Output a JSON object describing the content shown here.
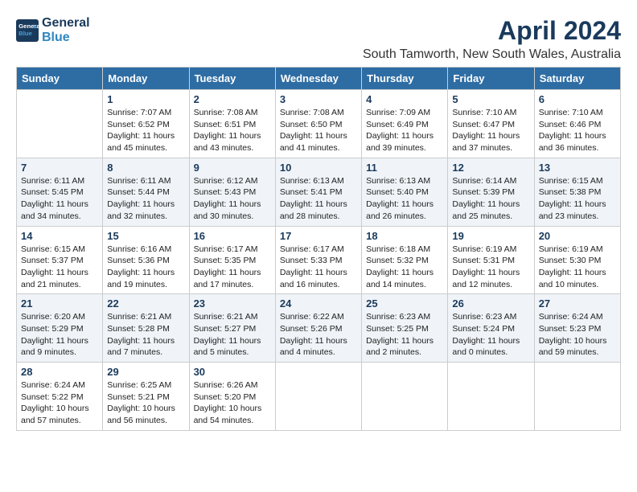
{
  "header": {
    "logo_line1": "General",
    "logo_line2": "Blue",
    "month_title": "April 2024",
    "subtitle": "South Tamworth, New South Wales, Australia"
  },
  "weekdays": [
    "Sunday",
    "Monday",
    "Tuesday",
    "Wednesday",
    "Thursday",
    "Friday",
    "Saturday"
  ],
  "weeks": [
    [
      null,
      {
        "day": "1",
        "sunrise": "7:07 AM",
        "sunset": "6:52 PM",
        "daylight": "11 hours and 45 minutes."
      },
      {
        "day": "2",
        "sunrise": "7:08 AM",
        "sunset": "6:51 PM",
        "daylight": "11 hours and 43 minutes."
      },
      {
        "day": "3",
        "sunrise": "7:08 AM",
        "sunset": "6:50 PM",
        "daylight": "11 hours and 41 minutes."
      },
      {
        "day": "4",
        "sunrise": "7:09 AM",
        "sunset": "6:49 PM",
        "daylight": "11 hours and 39 minutes."
      },
      {
        "day": "5",
        "sunrise": "7:10 AM",
        "sunset": "6:47 PM",
        "daylight": "11 hours and 37 minutes."
      },
      {
        "day": "6",
        "sunrise": "7:10 AM",
        "sunset": "6:46 PM",
        "daylight": "11 hours and 36 minutes."
      }
    ],
    [
      {
        "day": "7",
        "sunrise": "6:11 AM",
        "sunset": "5:45 PM",
        "daylight": "11 hours and 34 minutes."
      },
      {
        "day": "8",
        "sunrise": "6:11 AM",
        "sunset": "5:44 PM",
        "daylight": "11 hours and 32 minutes."
      },
      {
        "day": "9",
        "sunrise": "6:12 AM",
        "sunset": "5:43 PM",
        "daylight": "11 hours and 30 minutes."
      },
      {
        "day": "10",
        "sunrise": "6:13 AM",
        "sunset": "5:41 PM",
        "daylight": "11 hours and 28 minutes."
      },
      {
        "day": "11",
        "sunrise": "6:13 AM",
        "sunset": "5:40 PM",
        "daylight": "11 hours and 26 minutes."
      },
      {
        "day": "12",
        "sunrise": "6:14 AM",
        "sunset": "5:39 PM",
        "daylight": "11 hours and 25 minutes."
      },
      {
        "day": "13",
        "sunrise": "6:15 AM",
        "sunset": "5:38 PM",
        "daylight": "11 hours and 23 minutes."
      }
    ],
    [
      {
        "day": "14",
        "sunrise": "6:15 AM",
        "sunset": "5:37 PM",
        "daylight": "11 hours and 21 minutes."
      },
      {
        "day": "15",
        "sunrise": "6:16 AM",
        "sunset": "5:36 PM",
        "daylight": "11 hours and 19 minutes."
      },
      {
        "day": "16",
        "sunrise": "6:17 AM",
        "sunset": "5:35 PM",
        "daylight": "11 hours and 17 minutes."
      },
      {
        "day": "17",
        "sunrise": "6:17 AM",
        "sunset": "5:33 PM",
        "daylight": "11 hours and 16 minutes."
      },
      {
        "day": "18",
        "sunrise": "6:18 AM",
        "sunset": "5:32 PM",
        "daylight": "11 hours and 14 minutes."
      },
      {
        "day": "19",
        "sunrise": "6:19 AM",
        "sunset": "5:31 PM",
        "daylight": "11 hours and 12 minutes."
      },
      {
        "day": "20",
        "sunrise": "6:19 AM",
        "sunset": "5:30 PM",
        "daylight": "11 hours and 10 minutes."
      }
    ],
    [
      {
        "day": "21",
        "sunrise": "6:20 AM",
        "sunset": "5:29 PM",
        "daylight": "11 hours and 9 minutes."
      },
      {
        "day": "22",
        "sunrise": "6:21 AM",
        "sunset": "5:28 PM",
        "daylight": "11 hours and 7 minutes."
      },
      {
        "day": "23",
        "sunrise": "6:21 AM",
        "sunset": "5:27 PM",
        "daylight": "11 hours and 5 minutes."
      },
      {
        "day": "24",
        "sunrise": "6:22 AM",
        "sunset": "5:26 PM",
        "daylight": "11 hours and 4 minutes."
      },
      {
        "day": "25",
        "sunrise": "6:23 AM",
        "sunset": "5:25 PM",
        "daylight": "11 hours and 2 minutes."
      },
      {
        "day": "26",
        "sunrise": "6:23 AM",
        "sunset": "5:24 PM",
        "daylight": "11 hours and 0 minutes."
      },
      {
        "day": "27",
        "sunrise": "6:24 AM",
        "sunset": "5:23 PM",
        "daylight": "10 hours and 59 minutes."
      }
    ],
    [
      {
        "day": "28",
        "sunrise": "6:24 AM",
        "sunset": "5:22 PM",
        "daylight": "10 hours and 57 minutes."
      },
      {
        "day": "29",
        "sunrise": "6:25 AM",
        "sunset": "5:21 PM",
        "daylight": "10 hours and 56 minutes."
      },
      {
        "day": "30",
        "sunrise": "6:26 AM",
        "sunset": "5:20 PM",
        "daylight": "10 hours and 54 minutes."
      },
      null,
      null,
      null,
      null
    ]
  ],
  "labels": {
    "sunrise": "Sunrise: ",
    "sunset": "Sunset: ",
    "daylight": "Daylight: "
  }
}
